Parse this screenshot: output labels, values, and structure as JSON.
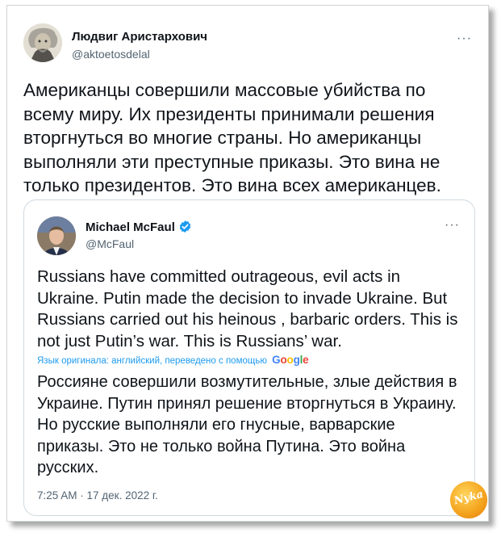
{
  "outer_tweet": {
    "author_name": "Людвиг Аристархович",
    "author_handle": "@aktoetosdelal",
    "more_icon": "more-dots-icon",
    "text": "Американцы совершили массовые убийства по всему миру. Их президенты принимали решения вторгнуться во многие страны. Но американцы выполняли эти преступные приказы. Это вина не только президентов. Это вина всех американцев."
  },
  "quoted_tweet": {
    "author_name": "Michael McFaul",
    "author_handle": "@McFaul",
    "verified_icon": "verified-badge-icon",
    "more_icon": "more-dots-icon",
    "text_original": "Russians have committed outrageous, evil acts in Ukraine. Putin made the decision to invade Ukraine. But Russians carried out his heinous , barbaric orders. This is not just Putin’s war. This is Russians’ war.",
    "translation_note": "Язык оригинала: английский, переведено с помощью",
    "translation_provider": "Google",
    "text_translated": "Россияне совершили возмутительные, злые действия в Украине. Путин принял решение вторгнуться в Украину. Но русские выполняли его гнусные, варварские приказы. Это не только война Путина. Это война русских.",
    "timestamp": "7:25 AM · 17 дек. 2022 г."
  },
  "watermark": {
    "text": "Nyka"
  },
  "colors": {
    "text": "#0f1419",
    "secondary": "#536471",
    "link": "#1d9bf0",
    "border": "#cfd9de",
    "verified": "#1d9bf0"
  }
}
